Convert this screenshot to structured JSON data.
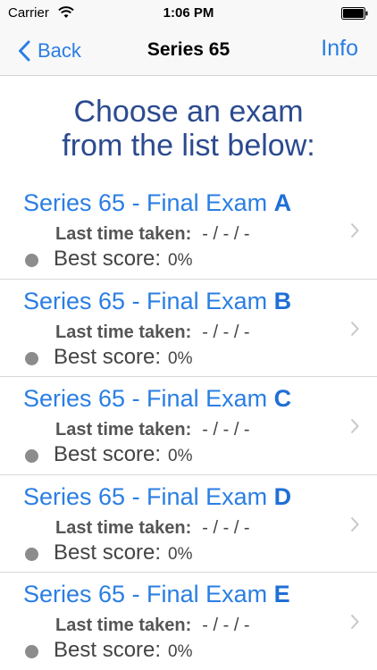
{
  "status_bar": {
    "carrier": "Carrier",
    "time": "1:06 PM",
    "icons": [
      "wifi-icon",
      "battery-icon"
    ]
  },
  "nav": {
    "back_label": "Back",
    "title": "Series 65",
    "info_label": "Info",
    "icons": [
      "chevron-left-icon"
    ]
  },
  "heading": {
    "line1": "Choose an exam",
    "line2": "from the list below:"
  },
  "exams": [
    {
      "title": "Series 65 - Final Exam",
      "letter": "A",
      "last_taken_label": "Last time taken:",
      "last_taken_value": "- / - / -",
      "best_score_label": "Best score:",
      "best_score_value": "0%"
    },
    {
      "title": "Series 65 - Final Exam",
      "letter": "B",
      "last_taken_label": "Last time taken:",
      "last_taken_value": "- / - / -",
      "best_score_label": "Best score:",
      "best_score_value": "0%"
    },
    {
      "title": "Series 65 - Final Exam",
      "letter": "C",
      "last_taken_label": "Last time taken:",
      "last_taken_value": "- / - / -",
      "best_score_label": "Best score:",
      "best_score_value": "0%"
    },
    {
      "title": "Series 65 - Final Exam",
      "letter": "D",
      "last_taken_label": "Last time taken:",
      "last_taken_value": "- / - / -",
      "best_score_label": "Best score:",
      "best_score_value": "0%"
    },
    {
      "title": "Series 65 - Final Exam",
      "letter": "E",
      "last_taken_label": "Last time taken:",
      "last_taken_value": "- / - / -",
      "best_score_label": "Best score:",
      "best_score_value": "0%"
    }
  ],
  "colors": {
    "accent": "#2a7ee3",
    "heading": "#2b4a8f",
    "status_dot": "#8c8c8c"
  }
}
